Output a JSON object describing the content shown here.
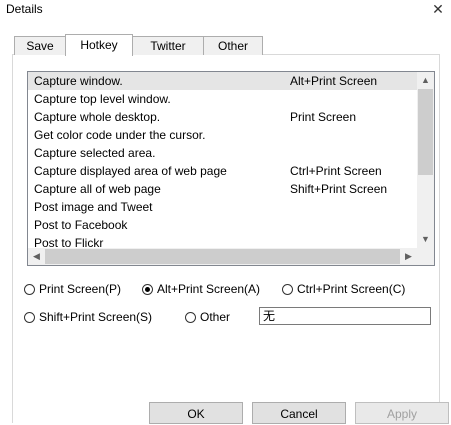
{
  "window": {
    "title": "Details",
    "close_glyph": "✕"
  },
  "tabs": [
    {
      "label": "Save",
      "active": false
    },
    {
      "label": "Hotkey",
      "active": true
    },
    {
      "label": "Twitter",
      "active": false
    },
    {
      "label": "Other",
      "active": false
    }
  ],
  "hotkey_list": {
    "items": [
      {
        "action": "Capture window.",
        "key": "Alt+Print Screen",
        "selected": true
      },
      {
        "action": "Capture top level window.",
        "key": ""
      },
      {
        "action": "Capture whole desktop.",
        "key": "Print Screen"
      },
      {
        "action": "Get color code under the cursor.",
        "key": ""
      },
      {
        "action": "Capture selected area.",
        "key": ""
      },
      {
        "action": "Capture displayed area of web page",
        "key": "Ctrl+Print Screen"
      },
      {
        "action": "Capture all of web page",
        "key": "Shift+Print Screen"
      },
      {
        "action": "Post image and Tweet",
        "key": ""
      },
      {
        "action": "Post to Facebook",
        "key": ""
      },
      {
        "action": "Post to Flickr",
        "key": ""
      }
    ],
    "scroll_up_glyph": "▲",
    "scroll_down_glyph": "▼",
    "scroll_left_glyph": "◀",
    "scroll_right_glyph": "▶"
  },
  "hotkey_options": {
    "print_screen": "Print Screen(P)",
    "alt_print_screen": "Alt+Print Screen(A)",
    "ctrl_print_screen": "Ctrl+Print Screen(C)",
    "shift_print_screen": "Shift+Print Screen(S)",
    "other": "Other",
    "selected": "alt_print_screen",
    "other_value": "无"
  },
  "buttons": {
    "ok": "OK",
    "cancel": "Cancel",
    "apply": "Apply"
  }
}
